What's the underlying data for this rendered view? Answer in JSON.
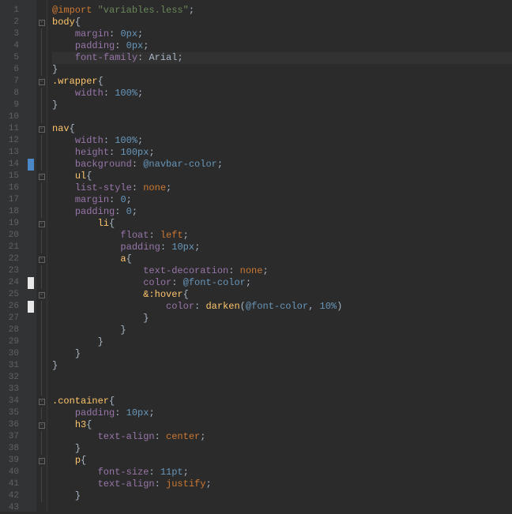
{
  "line_count": 43,
  "highlighted_line": 5,
  "markers": {
    "14": "blue",
    "24": "white",
    "26": "white"
  },
  "fold_nodes": [
    2,
    7,
    11,
    15,
    19,
    22,
    25,
    34,
    36,
    39
  ],
  "code_lines": [
    [
      {
        "c": "tok-at",
        "t": "@import "
      },
      {
        "c": "tok-str",
        "t": "\"variables.less\""
      },
      {
        "c": "tok-punc",
        "t": ";"
      }
    ],
    [
      {
        "c": "tok-sel",
        "t": "body"
      },
      {
        "c": "tok-punc",
        "t": "{"
      }
    ],
    [
      {
        "c": "",
        "t": "    "
      },
      {
        "c": "tok-prop",
        "t": "margin"
      },
      {
        "c": "tok-punc",
        "t": ": "
      },
      {
        "c": "tok-num",
        "t": "0"
      },
      {
        "c": "tok-unit",
        "t": "px"
      },
      {
        "c": "tok-punc",
        "t": ";"
      }
    ],
    [
      {
        "c": "",
        "t": "    "
      },
      {
        "c": "tok-prop",
        "t": "padding"
      },
      {
        "c": "tok-punc",
        "t": ": "
      },
      {
        "c": "tok-num",
        "t": "0"
      },
      {
        "c": "tok-unit",
        "t": "px"
      },
      {
        "c": "tok-punc",
        "t": ";"
      }
    ],
    [
      {
        "c": "",
        "t": "    "
      },
      {
        "c": "tok-prop",
        "t": "font-family"
      },
      {
        "c": "tok-punc",
        "t": ": "
      },
      {
        "c": "tok-val",
        "t": "Arial"
      },
      {
        "c": "tok-punc",
        "t": ";"
      }
    ],
    [
      {
        "c": "tok-punc",
        "t": "}"
      }
    ],
    [
      {
        "c": "tok-sel",
        "t": ".wrapper"
      },
      {
        "c": "tok-punc",
        "t": "{"
      }
    ],
    [
      {
        "c": "",
        "t": "    "
      },
      {
        "c": "tok-prop",
        "t": "width"
      },
      {
        "c": "tok-punc",
        "t": ": "
      },
      {
        "c": "tok-num",
        "t": "100"
      },
      {
        "c": "tok-unit",
        "t": "%"
      },
      {
        "c": "tok-punc",
        "t": ";"
      }
    ],
    [
      {
        "c": "tok-punc",
        "t": "}"
      }
    ],
    [],
    [
      {
        "c": "tok-sel",
        "t": "nav"
      },
      {
        "c": "tok-punc",
        "t": "{"
      }
    ],
    [
      {
        "c": "",
        "t": "    "
      },
      {
        "c": "tok-prop",
        "t": "width"
      },
      {
        "c": "tok-punc",
        "t": ": "
      },
      {
        "c": "tok-num",
        "t": "100"
      },
      {
        "c": "tok-unit",
        "t": "%"
      },
      {
        "c": "tok-punc",
        "t": ";"
      }
    ],
    [
      {
        "c": "",
        "t": "    "
      },
      {
        "c": "tok-prop",
        "t": "height"
      },
      {
        "c": "tok-punc",
        "t": ": "
      },
      {
        "c": "tok-num",
        "t": "100"
      },
      {
        "c": "tok-unit",
        "t": "px"
      },
      {
        "c": "tok-punc",
        "t": ";"
      }
    ],
    [
      {
        "c": "",
        "t": "    "
      },
      {
        "c": "tok-prop",
        "t": "background"
      },
      {
        "c": "tok-punc",
        "t": ": "
      },
      {
        "c": "tok-var",
        "t": "@navbar-color"
      },
      {
        "c": "tok-punc",
        "t": ";"
      }
    ],
    [
      {
        "c": "",
        "t": "    "
      },
      {
        "c": "tok-sel",
        "t": "ul"
      },
      {
        "c": "tok-punc",
        "t": "{"
      }
    ],
    [
      {
        "c": "",
        "t": "    "
      },
      {
        "c": "tok-prop",
        "t": "list-style"
      },
      {
        "c": "tok-punc",
        "t": ": "
      },
      {
        "c": "tok-none",
        "t": "none"
      },
      {
        "c": "tok-punc",
        "t": ";"
      }
    ],
    [
      {
        "c": "",
        "t": "    "
      },
      {
        "c": "tok-prop",
        "t": "margin"
      },
      {
        "c": "tok-punc",
        "t": ": "
      },
      {
        "c": "tok-num",
        "t": "0"
      },
      {
        "c": "tok-punc",
        "t": ";"
      }
    ],
    [
      {
        "c": "",
        "t": "    "
      },
      {
        "c": "tok-prop",
        "t": "padding"
      },
      {
        "c": "tok-punc",
        "t": ": "
      },
      {
        "c": "tok-num",
        "t": "0"
      },
      {
        "c": "tok-punc",
        "t": ";"
      }
    ],
    [
      {
        "c": "",
        "t": "        "
      },
      {
        "c": "tok-sel",
        "t": "li"
      },
      {
        "c": "tok-punc",
        "t": "{"
      }
    ],
    [
      {
        "c": "",
        "t": "            "
      },
      {
        "c": "tok-prop",
        "t": "float"
      },
      {
        "c": "tok-punc",
        "t": ": "
      },
      {
        "c": "tok-none",
        "t": "left"
      },
      {
        "c": "tok-punc",
        "t": ";"
      }
    ],
    [
      {
        "c": "",
        "t": "            "
      },
      {
        "c": "tok-prop",
        "t": "padding"
      },
      {
        "c": "tok-punc",
        "t": ": "
      },
      {
        "c": "tok-num",
        "t": "10"
      },
      {
        "c": "tok-unit",
        "t": "px"
      },
      {
        "c": "tok-punc",
        "t": ";"
      }
    ],
    [
      {
        "c": "",
        "t": "            "
      },
      {
        "c": "tok-sel",
        "t": "a"
      },
      {
        "c": "tok-punc",
        "t": "{"
      }
    ],
    [
      {
        "c": "",
        "t": "                "
      },
      {
        "c": "tok-prop",
        "t": "text-decoration"
      },
      {
        "c": "tok-punc",
        "t": ": "
      },
      {
        "c": "tok-none",
        "t": "none"
      },
      {
        "c": "tok-punc",
        "t": ";"
      }
    ],
    [
      {
        "c": "",
        "t": "                "
      },
      {
        "c": "tok-prop",
        "t": "color"
      },
      {
        "c": "tok-punc",
        "t": ": "
      },
      {
        "c": "tok-var",
        "t": "@font-color"
      },
      {
        "c": "tok-punc",
        "t": ";"
      }
    ],
    [
      {
        "c": "",
        "t": "                "
      },
      {
        "c": "tok-sel",
        "t": "&:hover"
      },
      {
        "c": "tok-punc",
        "t": "{"
      }
    ],
    [
      {
        "c": "",
        "t": "                    "
      },
      {
        "c": "tok-prop",
        "t": "color"
      },
      {
        "c": "tok-punc",
        "t": ": "
      },
      {
        "c": "tok-func",
        "t": "darken"
      },
      {
        "c": "tok-punc",
        "t": "("
      },
      {
        "c": "tok-var",
        "t": "@font-color"
      },
      {
        "c": "tok-punc",
        "t": ", "
      },
      {
        "c": "tok-num",
        "t": "10"
      },
      {
        "c": "tok-unit",
        "t": "%"
      },
      {
        "c": "tok-punc",
        "t": ")"
      }
    ],
    [
      {
        "c": "",
        "t": "                "
      },
      {
        "c": "tok-punc",
        "t": "}"
      }
    ],
    [
      {
        "c": "",
        "t": "            "
      },
      {
        "c": "tok-punc",
        "t": "}"
      }
    ],
    [
      {
        "c": "",
        "t": "        "
      },
      {
        "c": "tok-punc",
        "t": "}"
      }
    ],
    [
      {
        "c": "",
        "t": "    "
      },
      {
        "c": "tok-punc",
        "t": "}"
      }
    ],
    [
      {
        "c": "tok-punc",
        "t": "}"
      }
    ],
    [],
    [],
    [
      {
        "c": "tok-sel",
        "t": ".container"
      },
      {
        "c": "tok-punc",
        "t": "{"
      }
    ],
    [
      {
        "c": "",
        "t": "    "
      },
      {
        "c": "tok-prop",
        "t": "padding"
      },
      {
        "c": "tok-punc",
        "t": ": "
      },
      {
        "c": "tok-num",
        "t": "10"
      },
      {
        "c": "tok-unit",
        "t": "px"
      },
      {
        "c": "tok-punc",
        "t": ";"
      }
    ],
    [
      {
        "c": "",
        "t": "    "
      },
      {
        "c": "tok-sel",
        "t": "h3"
      },
      {
        "c": "tok-punc",
        "t": "{"
      }
    ],
    [
      {
        "c": "",
        "t": "        "
      },
      {
        "c": "tok-prop",
        "t": "text-align"
      },
      {
        "c": "tok-punc",
        "t": ": "
      },
      {
        "c": "tok-none",
        "t": "center"
      },
      {
        "c": "tok-punc",
        "t": ";"
      }
    ],
    [
      {
        "c": "",
        "t": "    "
      },
      {
        "c": "tok-punc",
        "t": "}"
      }
    ],
    [
      {
        "c": "",
        "t": "    "
      },
      {
        "c": "tok-sel",
        "t": "p"
      },
      {
        "c": "tok-punc",
        "t": "{"
      }
    ],
    [
      {
        "c": "",
        "t": "        "
      },
      {
        "c": "tok-prop",
        "t": "font-size"
      },
      {
        "c": "tok-punc",
        "t": ": "
      },
      {
        "c": "tok-num",
        "t": "11"
      },
      {
        "c": "tok-unit",
        "t": "pt"
      },
      {
        "c": "tok-punc",
        "t": ";"
      }
    ],
    [
      {
        "c": "",
        "t": "        "
      },
      {
        "c": "tok-prop",
        "t": "text-align"
      },
      {
        "c": "tok-punc",
        "t": ": "
      },
      {
        "c": "tok-none",
        "t": "justify"
      },
      {
        "c": "tok-punc",
        "t": ";"
      }
    ],
    [
      {
        "c": "",
        "t": "    "
      },
      {
        "c": "tok-punc",
        "t": "}"
      }
    ],
    []
  ]
}
